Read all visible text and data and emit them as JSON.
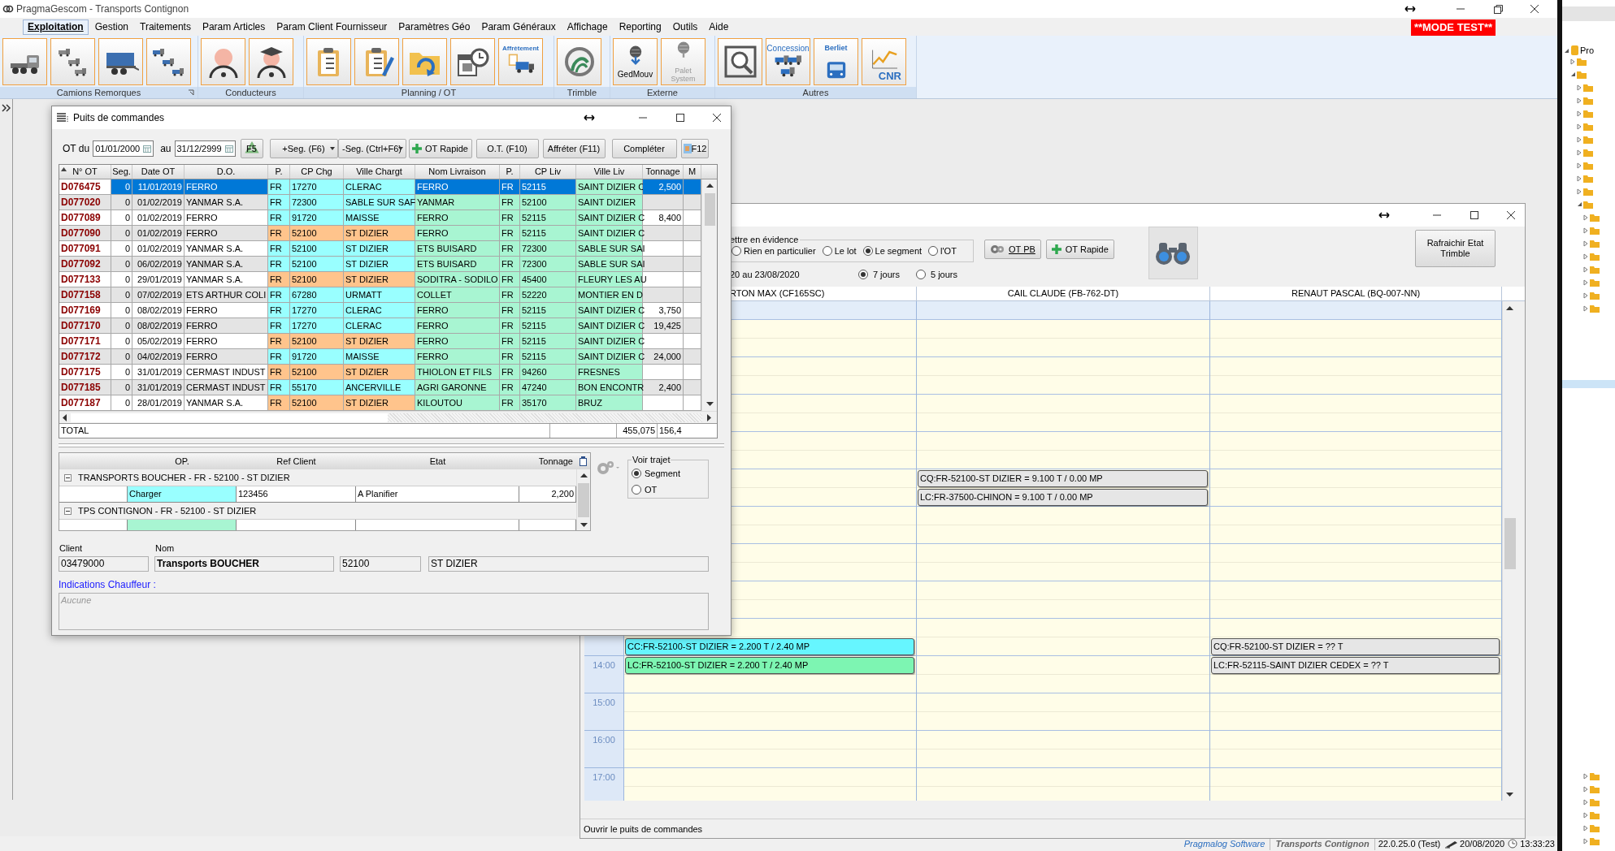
{
  "app": {
    "title": "PragmaGescom - Transports Contignon",
    "badge": "**MODE TEST**"
  },
  "menu": [
    {
      "label": "Exploitation",
      "selected": true
    },
    {
      "label": "Gestion",
      "selected": false
    },
    {
      "label": "Traitements",
      "selected": false
    },
    {
      "label": "Param Articles",
      "selected": false
    },
    {
      "label": "Param Client Fournisseur",
      "selected": false
    },
    {
      "label": "Paramètres Géo",
      "selected": false
    },
    {
      "label": "Param Généraux",
      "selected": false
    },
    {
      "label": "Affichage",
      "selected": false
    },
    {
      "label": "Reporting",
      "selected": false
    },
    {
      "label": "Outils",
      "selected": false
    },
    {
      "label": "Aide",
      "selected": false
    }
  ],
  "ribbon": [
    {
      "label": "Camions Remorques",
      "launcher": true,
      "buttons": [
        {
          "kind": "truck"
        },
        {
          "kind": "trucks"
        },
        {
          "kind": "trailer"
        },
        {
          "kind": "trailers"
        }
      ]
    },
    {
      "label": "Conducteurs",
      "launcher": false,
      "buttons": [
        {
          "kind": "driver"
        },
        {
          "kind": "graduate"
        }
      ]
    },
    {
      "label": "Planning / OT",
      "launcher": false,
      "buttons": [
        {
          "kind": "clipboard"
        },
        {
          "kind": "clipboard_edit"
        },
        {
          "kind": "folder"
        },
        {
          "kind": "calendar"
        },
        {
          "kind": "freight",
          "label": "Affrètement"
        }
      ]
    },
    {
      "label": "Trimble",
      "launcher": false,
      "buttons": [
        {
          "kind": "trimble"
        }
      ]
    },
    {
      "label": "Externe",
      "launcher": false,
      "buttons": [
        {
          "kind": "gedmouv",
          "label": "GedMouv"
        },
        {
          "kind": "palet",
          "label": "Palet System"
        }
      ]
    },
    {
      "label": "Autres",
      "launcher": false,
      "buttons": [
        {
          "kind": "magnifier"
        },
        {
          "kind": "concession",
          "label": "Concession"
        },
        {
          "kind": "bus",
          "label": "Berliet"
        },
        {
          "kind": "cnr",
          "label": "CNR"
        }
      ]
    }
  ],
  "orders": {
    "title": "Puits de commandes",
    "from_label": "OT du",
    "from": "01/01/2000",
    "to_label": "au",
    "to": "31/12/2999",
    "tools": [
      {
        "kind": "refresh",
        "label": "F5"
      },
      {
        "kind": "dropdown",
        "label": "+Seg. (F6)"
      },
      {
        "kind": "dropdown",
        "label": "-Seg. (Ctrl+F6)"
      },
      {
        "kind": "add",
        "label": "OT Rapide"
      },
      {
        "kind": "plain",
        "label": "O.T. (F10)"
      },
      {
        "kind": "plain",
        "label": "Affréter (F11)"
      },
      {
        "kind": "plain",
        "label": "Compléter"
      },
      {
        "kind": "image",
        "label": "F12"
      }
    ],
    "columns": [
      "N° OT",
      "Seg.",
      "Date OT",
      "D.O.",
      "P.",
      "CP Chg",
      "Ville Chargt",
      "Nom Livraison",
      "P.",
      "CP Liv",
      "Ville Liv",
      "Tonnage",
      "M"
    ],
    "rows": [
      {
        "selected": true,
        "color": "#99ffff",
        "cells": [
          "D076475",
          "0",
          "11/01/2019",
          "FERRO",
          "FR",
          "17270",
          "CLERAC",
          "FERRO",
          "FR",
          "52115",
          "SAINT DIZIER C",
          "2,500"
        ]
      },
      {
        "selected": false,
        "color": "#99ffff",
        "cells": [
          "D077020",
          "0",
          "01/02/2019",
          "YANMAR S.A.",
          "FR",
          "72300",
          "SABLE SUR SAF",
          "YANMAR",
          "FR",
          "52100",
          "SAINT DIZIER"
        ]
      },
      {
        "selected": false,
        "color": "#99ffff",
        "cells": [
          "D077089",
          "0",
          "01/02/2019",
          "FERRO",
          "FR",
          "91720",
          "MAISSE",
          "FERRO",
          "FR",
          "52115",
          "SAINT DIZIER C",
          "8,400"
        ]
      },
      {
        "selected": false,
        "color": "#ffc48c",
        "cells": [
          "D077090",
          "0",
          "01/02/2019",
          "FERRO",
          "FR",
          "52100",
          "ST DIZIER",
          "FERRO",
          "FR",
          "52115",
          "SAINT DIZIER C"
        ]
      },
      {
        "selected": false,
        "color": "#99ffff",
        "cells": [
          "D077091",
          "0",
          "01/02/2019",
          "YANMAR S.A.",
          "FR",
          "52100",
          "ST DIZIER",
          "ETS BUISARD",
          "FR",
          "72300",
          "SABLE SUR SAI"
        ]
      },
      {
        "selected": false,
        "color": "#99ffff",
        "cells": [
          "D077092",
          "0",
          "06/02/2019",
          "YANMAR S.A.",
          "FR",
          "52100",
          "ST DIZIER",
          "ETS BUISARD",
          "FR",
          "72300",
          "SABLE SUR SAI"
        ]
      },
      {
        "selected": false,
        "color": "#ffc48c",
        "cells": [
          "D077133",
          "0",
          "29/01/2019",
          "YANMAR S.A.",
          "FR",
          "52100",
          "ST DIZIER",
          "SODITRA - SODILO",
          "FR",
          "45400",
          "FLEURY LES AU"
        ]
      },
      {
        "selected": false,
        "color": "#99ffff",
        "cells": [
          "D077158",
          "0",
          "07/02/2019",
          "ETS ARTHUR COLI",
          "FR",
          "67280",
          "URMATT",
          "COLLET",
          "FR",
          "52220",
          "MONTIER EN D"
        ]
      },
      {
        "selected": false,
        "color": "#99ffff",
        "cells": [
          "D077169",
          "0",
          "08/02/2019",
          "FERRO",
          "FR",
          "17270",
          "CLERAC",
          "FERRO",
          "FR",
          "52115",
          "SAINT DIZIER C",
          "3,750"
        ]
      },
      {
        "selected": false,
        "color": "#99ffff",
        "cells": [
          "D077170",
          "0",
          "08/02/2019",
          "FERRO",
          "FR",
          "17270",
          "CLERAC",
          "FERRO",
          "FR",
          "52115",
          "SAINT DIZIER C",
          "19,425"
        ]
      },
      {
        "selected": false,
        "color": "#ffc48c",
        "cells": [
          "D077171",
          "0",
          "05/02/2019",
          "FERRO",
          "FR",
          "52100",
          "ST DIZIER",
          "FERRO",
          "FR",
          "52115",
          "SAINT DIZIER C"
        ]
      },
      {
        "selected": false,
        "color": "#99ffff",
        "cells": [
          "D077172",
          "0",
          "04/02/2019",
          "FERRO",
          "FR",
          "91720",
          "MAISSE",
          "FERRO",
          "FR",
          "52115",
          "SAINT DIZIER C",
          "24,000"
        ]
      },
      {
        "selected": false,
        "color": "#ffc48c",
        "cells": [
          "D077175",
          "0",
          "31/01/2019",
          "CERMAST INDUST",
          "FR",
          "52100",
          "ST DIZIER",
          "THIOLON ET FILS",
          "FR",
          "94260",
          "FRESNES"
        ]
      },
      {
        "selected": false,
        "color": "#99ffff",
        "cells": [
          "D077185",
          "0",
          "31/01/2019",
          "CERMAST INDUST",
          "FR",
          "55170",
          "ANCERVILLE",
          "AGRI GARONNE",
          "FR",
          "47240",
          "BON ENCONTR",
          "2,400"
        ]
      },
      {
        "selected": false,
        "color": "#ffc48c",
        "cells": [
          "D077187",
          "0",
          "28/01/2019",
          "YANMAR S.A.",
          "FR",
          "52100",
          "ST DIZIER",
          "KILOUTOU",
          "FR",
          "35170",
          "BRUZ"
        ]
      }
    ],
    "total": {
      "label": "TOTAL",
      "tonnage": "455,075",
      "column_13": "156,4"
    },
    "ops": {
      "columns": [
        "OP.",
        "Ref Client",
        "Etat",
        "Tonnage"
      ],
      "groups": [
        {
          "title": "TRANSPORTS BOUCHER - FR - 52100 - ST DIZIER",
          "expanded": true,
          "rows": [
            {
              "op": "Charger",
              "color": "#99ffff",
              "ref": "123456",
              "etat": "A Planifier",
              "tonnage": "2,200"
            }
          ]
        },
        {
          "title": "TPS CONTIGNON - FR - 52100 - ST DIZIER",
          "expanded": true
        }
      ]
    },
    "route": {
      "title": "Voir trajet",
      "options": [
        {
          "label": "Segment",
          "selected": true
        },
        {
          "label": "OT",
          "selected": false
        }
      ]
    },
    "client": {
      "client_label": "Client",
      "client": "03479000",
      "name_label": "Nom",
      "name": "Transports BOUCHER",
      "postcode": "52100",
      "city": "ST DIZIER"
    },
    "notes": {
      "label": "Indications Chauffeur :",
      "placeholder": "Aucune"
    }
  },
  "planning": {
    "highlight": {
      "title": "ettre en évidence",
      "options": [
        {
          "label": "Rien en particulier",
          "selected": false
        },
        {
          "label": "Le lot",
          "selected": false
        },
        {
          "label": "Le segment",
          "selected": true
        },
        {
          "label": "l'OT",
          "selected": false
        }
      ]
    },
    "period": "20 au 23/08/2020",
    "days": [
      {
        "label": "7 jours",
        "selected": true
      },
      {
        "label": "5 jours",
        "selected": false
      }
    ],
    "buttons": [
      {
        "kind": "gear",
        "label": "OT PB"
      },
      {
        "kind": "add",
        "label": "OT Rapide"
      }
    ],
    "refresh": "Rafraichir Etat Trimble",
    "drivers": [
      {
        "name": "RTON MAX (CF165SC)",
        "events": [
          {
            "text": "CC:FR-52100-ST DIZIER = 2.200 T / 2.40 MP",
            "color": "#66f6ff"
          },
          {
            "text": "LC:FR-52100-ST DIZIER = 2.200 T / 2.40 MP",
            "color": "#7df5b2"
          }
        ]
      },
      {
        "name": "CAIL CLAUDE (FB-762-DT)",
        "events": [
          {
            "text": "CQ:FR-52100-ST DIZIER = 9.100 T / 0.00 MP",
            "color": "#e6e6e6"
          },
          {
            "text": "LC:FR-37500-CHINON = 9.100 T / 0.00 MP",
            "color": "#e6e6e6"
          }
        ]
      },
      {
        "name": "RENAUT PASCAL (BQ-007-NN)",
        "events": [
          {
            "text": "CQ:FR-52100-ST DIZIER = ?? T",
            "color": "#e6e6e6"
          },
          {
            "text": "LC:FR-52115-SAINT DIZIER CEDEX = ?? T",
            "color": "#e6e6e6"
          }
        ]
      }
    ],
    "hours": [
      "14:00",
      "15:00",
      "16:00",
      "17:00"
    ],
    "status": "Ouvrir le puits de commandes"
  },
  "status_bar": [
    {
      "kind": "link",
      "text": "Pragmalog Software"
    },
    {
      "kind": "company",
      "text": "Transports Contignon"
    },
    {
      "kind": "version",
      "text": "22.0.25.0 (Test)"
    },
    {
      "kind": "date",
      "text": "20/08/2020"
    },
    {
      "kind": "time",
      "text": "13:33:23"
    }
  ],
  "side_panel": {
    "title": "Pro"
  }
}
